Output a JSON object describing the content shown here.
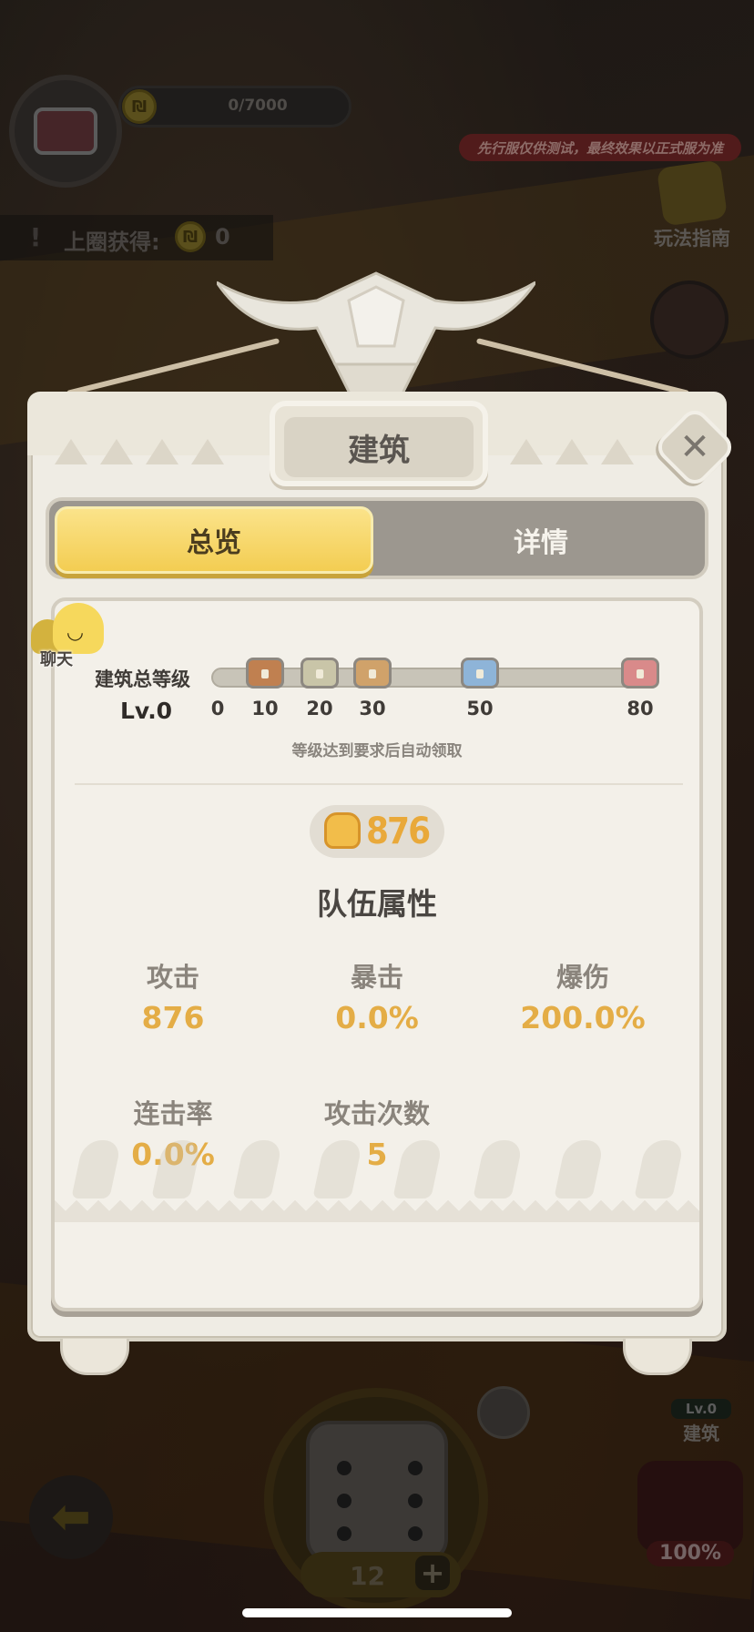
{
  "hud": {
    "chest_progress": "0/7000",
    "coin_glyph": "₪",
    "last_round_label": "上圈获得:",
    "last_round_value": "0",
    "test_banner": "先行服仅供测试，最终效果以正式服为准",
    "guide_label": "玩法指南",
    "dice_count": "12",
    "dice_plus": "+",
    "building_level": "Lv.0",
    "building_label": "建筑",
    "boss_percent": "100%"
  },
  "dialog": {
    "title": "建筑",
    "close_glyph": "✕",
    "tabs": [
      {
        "label": "总览",
        "active": true
      },
      {
        "label": "详情",
        "active": false
      }
    ],
    "chat_label": "聊天",
    "level_title": "建筑总等级",
    "level_value": "Lv.0",
    "milestones": [
      "0",
      "10",
      "20",
      "30",
      "50",
      "80"
    ],
    "auto_claim_note": "等级达到要求后自动领取",
    "power_value": "876",
    "section_title": "队伍属性",
    "stats": [
      {
        "label": "攻击",
        "value": "876"
      },
      {
        "label": "暴击",
        "value": "0.0%"
      },
      {
        "label": "爆伤",
        "value": "200.0%"
      },
      {
        "label": "连击率",
        "value": "0.0%"
      },
      {
        "label": "攻击次数",
        "value": "5"
      }
    ]
  },
  "colors": {
    "active_tab": "#f3cd52",
    "stat_value": "#e4ad46",
    "panel_bg": "#efece4",
    "banner_bg": "#7d2a2a"
  },
  "icons": {
    "close": "close-icon",
    "chat": "chat-bubble-icon",
    "power": "fist-icon",
    "milestone": "treasure-chest-icon",
    "back": "arrow-left-icon",
    "dice": "dice-icon",
    "add": "plus-icon"
  }
}
